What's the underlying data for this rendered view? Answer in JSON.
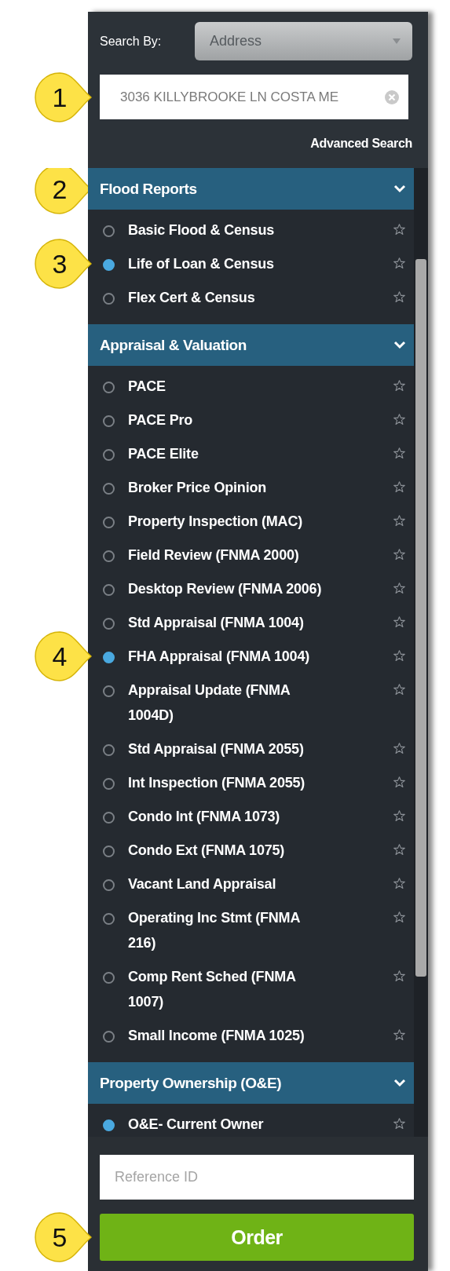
{
  "search_by": {
    "label": "Search By:",
    "value": "Address"
  },
  "address_field": {
    "value": "3036 KILLYBROOKE LN COSTA ME",
    "callout": "1"
  },
  "advanced_search": "Advanced Search",
  "sections": [
    {
      "title": "Flood Reports",
      "expanded": true,
      "callout": "2",
      "items": [
        {
          "label": "Basic Flood & Census",
          "selected": false
        },
        {
          "label": "Life of Loan & Census",
          "selected": true,
          "callout": "3"
        },
        {
          "label": "Flex Cert & Census",
          "selected": false
        }
      ]
    },
    {
      "title": "Appraisal & Valuation",
      "expanded": true,
      "items": [
        {
          "label": "PACE",
          "selected": false
        },
        {
          "label": "PACE Pro",
          "selected": false
        },
        {
          "label": "PACE Elite",
          "selected": false
        },
        {
          "label": "Broker Price Opinion",
          "selected": false
        },
        {
          "label": "Property Inspection (MAC)",
          "selected": false
        },
        {
          "label": "Field Review (FNMA 2000)",
          "selected": false
        },
        {
          "label": "Desktop Review (FNMA 2006)",
          "selected": false
        },
        {
          "label": "Std Appraisal (FNMA 1004)",
          "selected": false
        },
        {
          "label": "FHA Appraisal (FNMA 1004)",
          "selected": true,
          "callout": "4"
        },
        {
          "label": "Appraisal Update (FNMA 1004D)",
          "selected": false
        },
        {
          "label": "Std Appraisal (FNMA 2055)",
          "selected": false
        },
        {
          "label": "Int Inspection (FNMA 2055)",
          "selected": false
        },
        {
          "label": "Condo Int (FNMA 1073)",
          "selected": false
        },
        {
          "label": "Condo Ext (FNMA 1075)",
          "selected": false
        },
        {
          "label": "Vacant Land Appraisal",
          "selected": false
        },
        {
          "label": "Operating Inc Stmt (FNMA 216)",
          "selected": false
        },
        {
          "label": "Comp Rent Sched (FNMA 1007)",
          "selected": false
        },
        {
          "label": "Small Income (FNMA 1025)",
          "selected": false
        }
      ]
    },
    {
      "title": "Property Ownership (O&E)",
      "expanded": true,
      "items": [
        {
          "label": "O&E- Current Owner",
          "selected": true
        }
      ]
    }
  ],
  "reference_field": {
    "placeholder": "Reference ID"
  },
  "order_button": {
    "label": "Order",
    "callout": "5"
  }
}
